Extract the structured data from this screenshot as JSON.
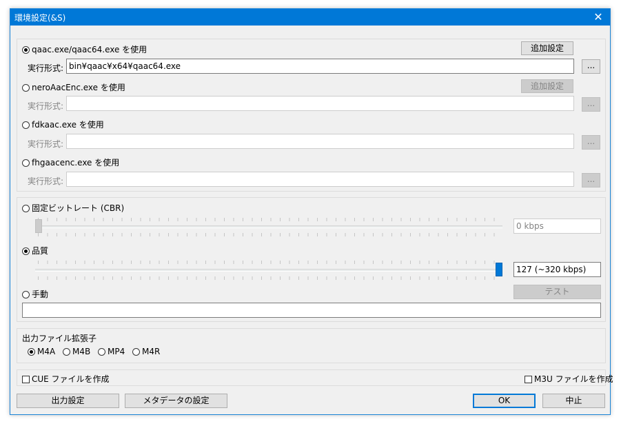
{
  "window": {
    "title": "環境設定(&S)",
    "close_glyph": "✕"
  },
  "encoders": [
    {
      "label": "qaac.exe/qaac64.exe を使用",
      "selected": true,
      "extra_label": "追加設定",
      "path_label": "実行形式:",
      "path_value": "bin¥qaac¥x64¥qaac64.exe",
      "browse_label": "...",
      "enabled": true
    },
    {
      "label": "neroAacEnc.exe を使用",
      "selected": false,
      "extra_label": "追加設定",
      "path_label": "実行形式:",
      "path_value": "",
      "browse_label": "...",
      "enabled": false
    },
    {
      "label": "fdkaac.exe を使用",
      "selected": false,
      "path_label": "実行形式:",
      "path_value": "",
      "browse_label": "...",
      "enabled": false
    },
    {
      "label": "fhgaacenc.exe を使用",
      "selected": false,
      "path_label": "実行形式:",
      "path_value": "",
      "browse_label": "...",
      "enabled": false
    }
  ],
  "mode": {
    "cbr_label": "固定ビットレート (CBR)",
    "cbr_selected": false,
    "cbr_value": "0 kbps",
    "cbr_slider_fraction": 0,
    "quality_label": "品質",
    "quality_selected": true,
    "quality_value": "127 (~320 kbps)",
    "quality_slider_fraction": 1,
    "manual_label": "手動",
    "manual_selected": false,
    "test_label": "テスト",
    "manual_value": ""
  },
  "extension": {
    "title": "出力ファイル拡張子",
    "options": [
      {
        "label": "M4A",
        "selected": true
      },
      {
        "label": "M4B",
        "selected": false
      },
      {
        "label": "MP4",
        "selected": false
      },
      {
        "label": "M4R",
        "selected": false
      }
    ]
  },
  "cue_label": "CUE ファイルを作成",
  "m3u_label": "M3U ファイルを作成",
  "buttons": {
    "output": "出力設定",
    "metadata": "メタデータの設定",
    "ok": "OK",
    "cancel": "中止"
  },
  "colors": {
    "titlebar": "#0078d7",
    "accent": "#0078d7",
    "disabled_text": "#838383"
  }
}
